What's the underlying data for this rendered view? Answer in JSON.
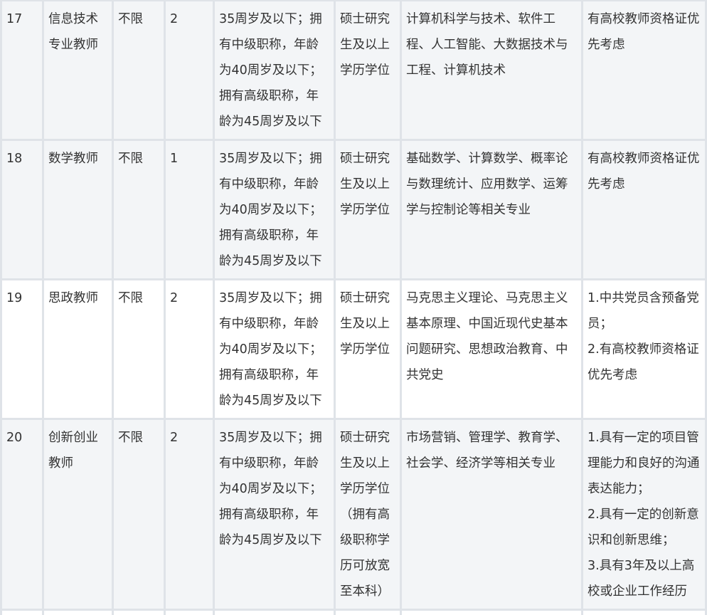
{
  "rows": [
    {
      "no": "17",
      "position": "信息技术专业教师",
      "gender": "不限",
      "count": "2",
      "age": "35周岁及以下；拥有中级职称，年龄为40周岁及以下；拥有高级职称，年龄为45周岁及以下",
      "education": "硕士研究生及以上学历学位",
      "major": "计算机科学与技术、软件工程、人工智能、大数据技术与工程、计算机技术",
      "other": "有高校教师资格证优先考虑"
    },
    {
      "no": "18",
      "position": "数学教师",
      "gender": "不限",
      "count": "1",
      "age": "35周岁及以下；拥有中级职称，年龄为40周岁及以下；拥有高级职称，年龄为45周岁及以下",
      "education": "硕士研究生及以上学历学位",
      "major": "基础数学、计算数学、概率论与数理统计、应用数学、运筹学与控制论等相关专业",
      "other": "有高校教师资格证优先考虑"
    },
    {
      "no": "19",
      "position": "思政教师",
      "gender": "不限",
      "count": "2",
      "age": "35周岁及以下；拥有中级职称，年龄为40周岁及以下；拥有高级职称，年龄为45周岁及以下",
      "education": "硕士研究生及以上学历学位",
      "major": "马克思主义理论、马克思主义基本原理、中国近现代史基本问题研究、思想政治教育、中共党史",
      "other": "1.中共党员含预备党员；\n2.有高校教师资格证优先考虑"
    },
    {
      "no": "20",
      "position": "创新创业教师",
      "gender": "不限",
      "count": "2",
      "age": "35周岁及以下；拥有中级职称，年龄为40周岁及以下；拥有高级职称，年龄为45周岁及以下",
      "education": "硕士研究生及以上学历学位（拥有高级职称学历可放宽至本科）",
      "major": "市场营销、管理学、教育学、社会学、经济学等相关专业",
      "other": "1.具有一定的项目管理能力和良好的沟通表达能力；\n2.具有一定的创新意识和创新思维；\n3.具有3年及以上高校或企业工作经历"
    }
  ],
  "colors": {
    "border": "#dfe3e8",
    "row_shade": "#f3f5f7",
    "row_plain": "#ffffff",
    "text": "#333333"
  }
}
